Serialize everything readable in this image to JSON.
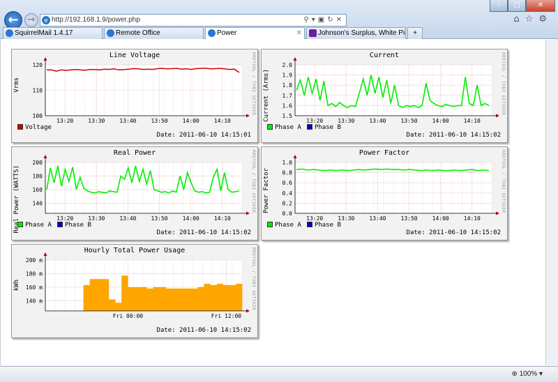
{
  "browser": {
    "address": "http://192.168.1.9/power.php",
    "tabs": [
      {
        "label": "SquirrelMail 1.4.17"
      },
      {
        "label": "Remote Office"
      },
      {
        "label": "Power"
      },
      {
        "label": "Johnson's Surplus, White Pige..."
      }
    ],
    "zoom": "100%",
    "new_tab": "+"
  },
  "colors": {
    "red": "#cc0000",
    "green": "#00ee00",
    "blue": "#0000cc",
    "orange": "#ffa500",
    "grid_minor": "#f0c8c8",
    "grid_major": "#d9a0a0"
  },
  "x_ticks": [
    "13:20",
    "13:30",
    "13:40",
    "13:50",
    "14:00",
    "14:10"
  ],
  "chart_data": [
    {
      "type": "line",
      "title": "Line Voltage",
      "ylabel": "Vrms",
      "ylim": [
        100,
        120
      ],
      "yticks": [
        "100",
        "110",
        "120"
      ],
      "xlim": [
        "13:13",
        "14:15"
      ],
      "series": [
        {
          "name": "Voltage",
          "values": [
            118,
            118,
            117.5,
            118,
            117.8,
            118,
            118.2,
            118,
            117.9,
            118.2,
            118.1,
            118,
            118.3,
            118.2,
            118.4,
            118,
            118.1,
            118.3,
            118.5,
            118.4,
            118.2,
            118.3,
            118.2,
            118.5,
            118.6,
            118.4,
            118.5,
            118.6,
            118.3,
            118.4,
            118.2,
            118.5,
            118.6,
            118.7,
            118.4,
            118.5,
            118.6,
            118.4,
            118.2,
            118.3,
            117
          ]
        }
      ],
      "date": "Date: 2011-06-10 14:15:01",
      "rrd": "RRDTOOL / TOBI OETIKER"
    },
    {
      "type": "line",
      "title": "Current",
      "ylabel": "Current (Arms)",
      "ylim": [
        1.5,
        2.0
      ],
      "yticks": [
        "1.5",
        "1.6",
        "1.7",
        "1.8",
        "1.9",
        "2.0"
      ],
      "series": [
        {
          "name": "Phase A",
          "values": [
            1.75,
            1.85,
            1.7,
            1.88,
            1.72,
            1.86,
            1.65,
            1.84,
            1.6,
            1.62,
            1.59,
            1.63,
            1.6,
            1.58,
            1.6,
            1.59,
            1.72,
            1.86,
            1.7,
            1.9,
            1.72,
            1.88,
            1.68,
            1.85,
            1.62,
            1.8,
            1.6,
            1.58,
            1.6,
            1.59,
            1.6,
            1.58,
            1.6,
            1.82,
            1.65,
            1.62,
            1.6,
            1.59,
            1.61,
            1.6,
            1.59,
            1.6,
            1.6,
            1.88,
            1.62,
            1.6,
            1.8,
            1.6,
            1.62,
            1.6
          ]
        },
        {
          "name": "Phase B",
          "values": []
        }
      ],
      "date": "Date: 2011-06-10 14:15:02",
      "rrd": "RRDTOOL / TOBI OETIKER"
    },
    {
      "type": "line",
      "title": "Real Power",
      "ylabel": "Real Power (WATTS)",
      "ylim": [
        125,
        200
      ],
      "yticks": [
        "140",
        "160",
        "180",
        "200"
      ],
      "series": [
        {
          "name": "Phase A",
          "values": [
            160,
            192,
            170,
            195,
            165,
            190,
            172,
            193,
            160,
            178,
            162,
            158,
            156,
            155,
            157,
            156,
            155,
            158,
            157,
            156,
            180,
            175,
            192,
            170,
            195,
            172,
            190,
            168,
            188,
            160,
            158,
            156,
            157,
            155,
            158,
            156,
            180,
            160,
            185,
            170,
            158,
            156,
            157,
            155,
            156,
            178,
            190,
            158,
            185,
            160,
            156,
            157,
            158
          ]
        },
        {
          "name": "Phase B",
          "values": []
        }
      ],
      "date": "Date: 2011-06-10 14:15:02",
      "rrd": "RRDTOOL / TOBI OETIKER"
    },
    {
      "type": "line",
      "title": "Power Factor",
      "ylabel": "Power Factor",
      "ylim": [
        0,
        1.0
      ],
      "yticks": [
        "0.0",
        "0.2",
        "0.4",
        "0.6",
        "0.8",
        "1.0"
      ],
      "series": [
        {
          "name": "Phase A",
          "values": [
            0.86,
            0.87,
            0.85,
            0.86,
            0.85,
            0.84,
            0.85,
            0.84,
            0.85,
            0.84,
            0.85,
            0.86,
            0.85,
            0.86,
            0.87,
            0.86,
            0.87,
            0.86,
            0.86,
            0.85,
            0.86,
            0.85,
            0.84,
            0.85,
            0.84,
            0.85,
            0.84,
            0.84,
            0.85,
            0.84,
            0.85,
            0.86,
            0.84,
            0.85,
            0.84
          ]
        },
        {
          "name": "Phase B",
          "values": []
        }
      ],
      "date": "Date: 2011-06-10 14:15:02",
      "rrd": "RRDTOOL / TOBI OETIKER"
    },
    {
      "type": "bar",
      "title": "Hourly Total Power Usage",
      "ylabel": "kWh",
      "ylim": [
        125,
        200
      ],
      "yticks": [
        "140 m",
        "160 m",
        "180 m",
        "200 m"
      ],
      "xticks": [
        "Fri 00:00",
        "Fri 12:00"
      ],
      "values": [
        0,
        0,
        0,
        0,
        0,
        0,
        163,
        172,
        172,
        172,
        142,
        137,
        177,
        160,
        160,
        160,
        158,
        160,
        160,
        158,
        158,
        158,
        158,
        158,
        160,
        165,
        163,
        165,
        163,
        163,
        165
      ],
      "date": "Date: 2011-06-10 14:15:02",
      "rrd": "RRDTOOL / TOBI OETIKER"
    }
  ]
}
